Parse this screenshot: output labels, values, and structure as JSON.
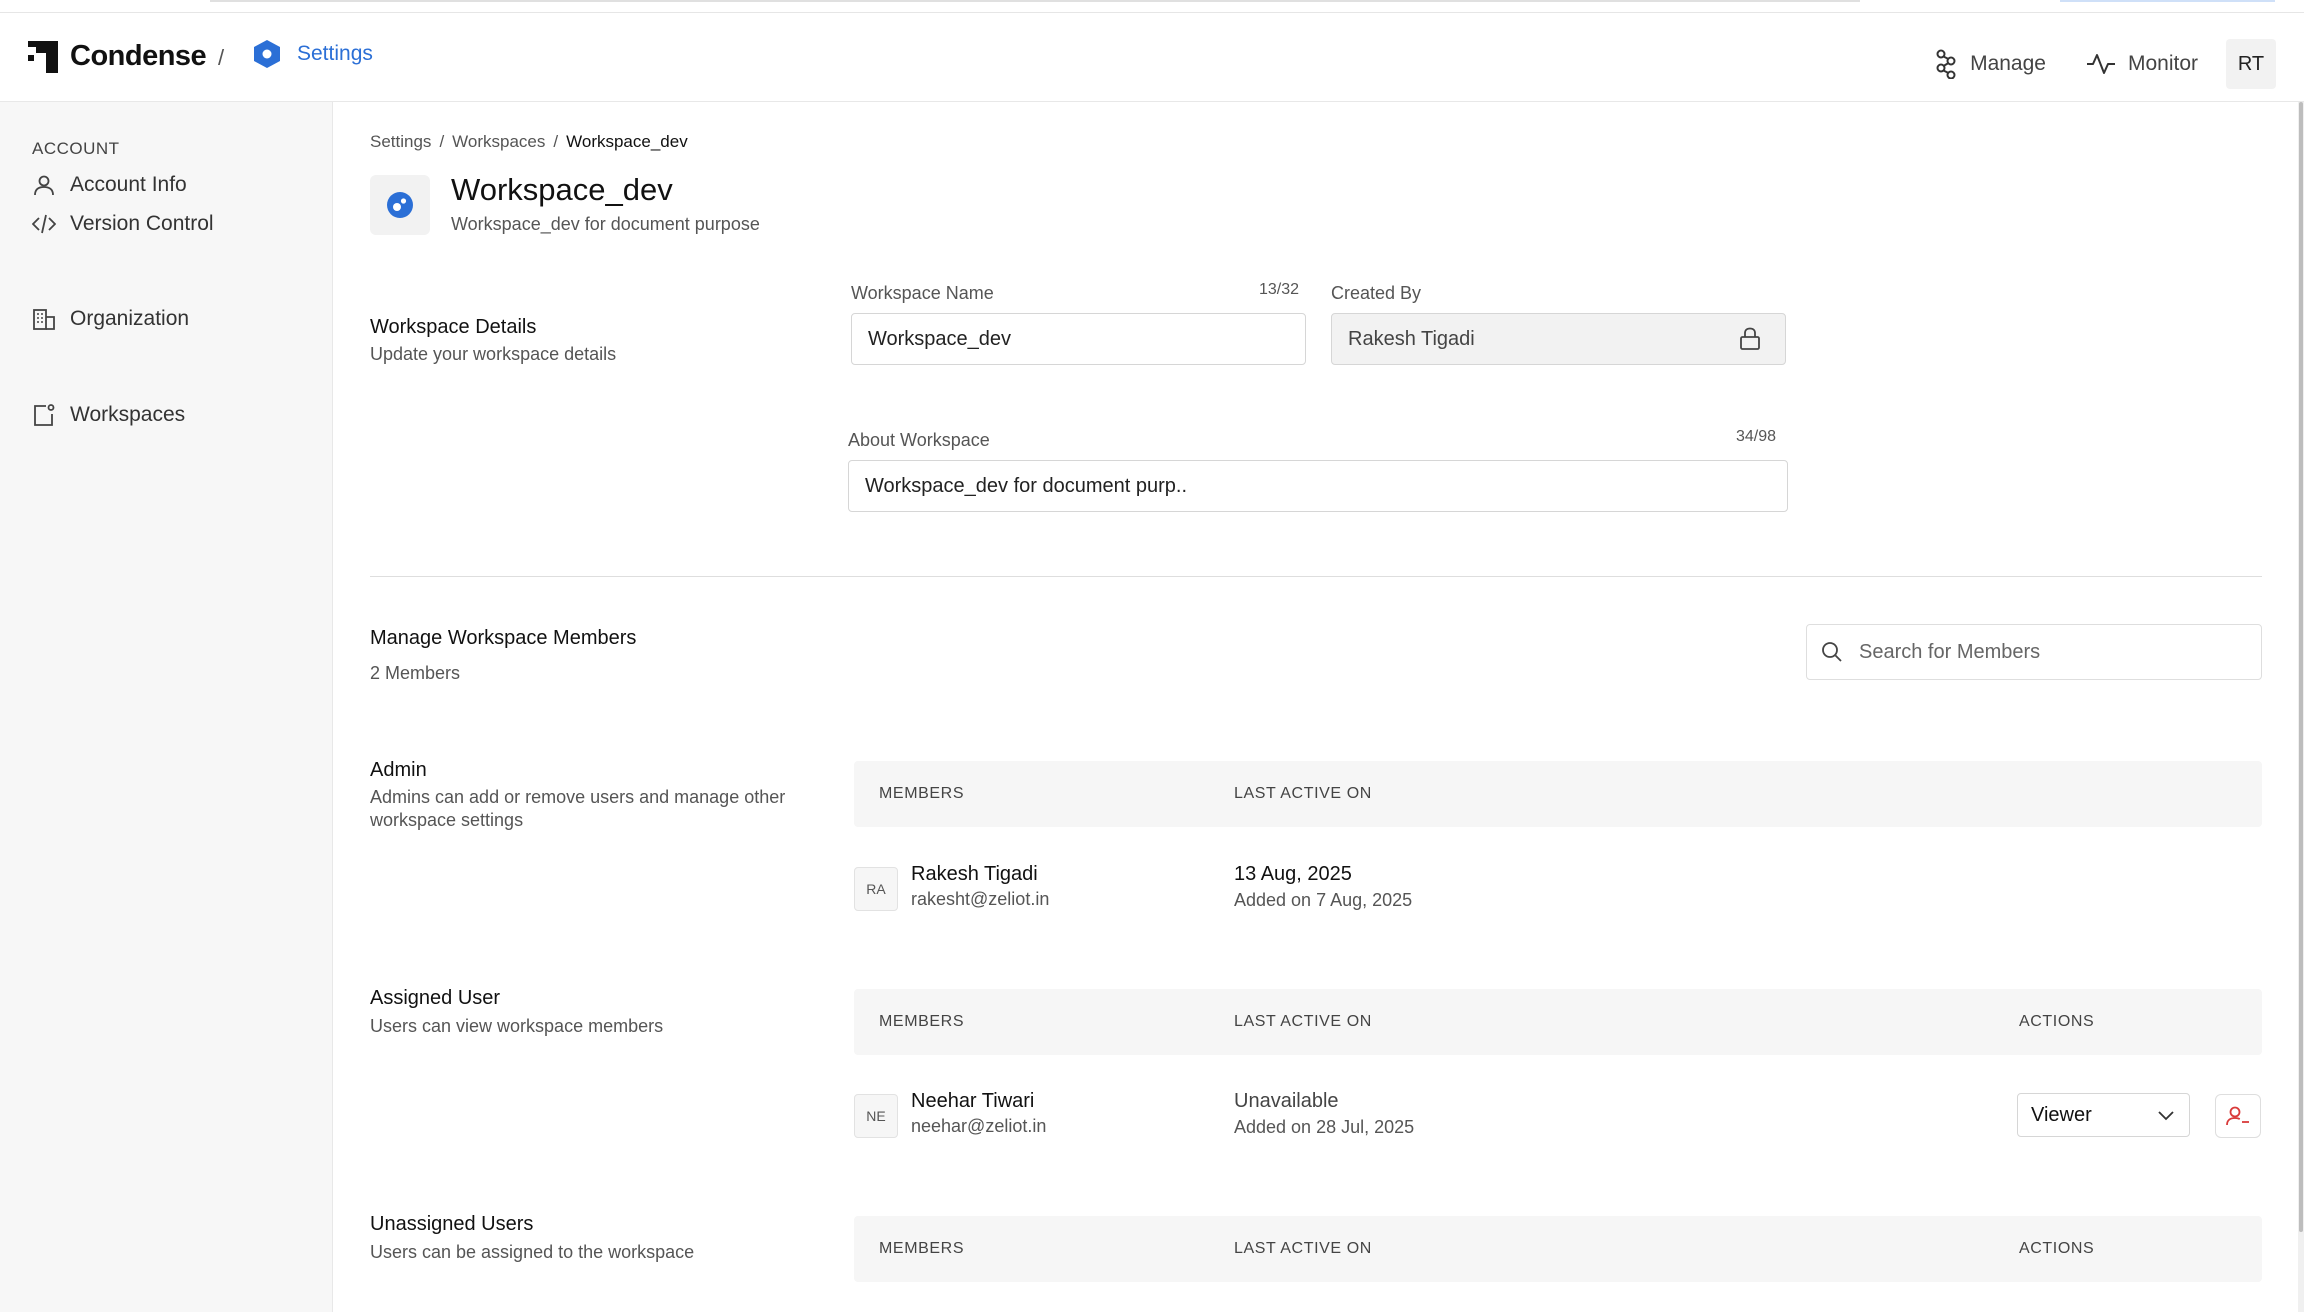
{
  "app": {
    "name": "Condense",
    "section": "Settings"
  },
  "nav": {
    "manage": "Manage",
    "monitor": "Monitor",
    "user_initials": "RT"
  },
  "sidebar": {
    "heading": "ACCOUNT",
    "items": [
      {
        "label": "Account Info",
        "icon": "user-icon"
      },
      {
        "label": "Version Control",
        "icon": "code-icon"
      },
      {
        "label": "Organization",
        "icon": "building-icon"
      },
      {
        "label": "Workspaces",
        "icon": "workspace-icon"
      }
    ]
  },
  "breadcrumb": [
    "Settings",
    "Workspaces",
    "Workspace_dev"
  ],
  "workspace": {
    "title": "Workspace_dev",
    "subtitle": "Workspace_dev for document purpose"
  },
  "details": {
    "title": "Workspace Details",
    "desc": "Update your workspace details",
    "name_label": "Workspace Name",
    "name_counter": "13/32",
    "name_value": "Workspace_dev",
    "created_label": "Created By",
    "created_value": "Rakesh Tigadi",
    "about_label": "About Workspace",
    "about_counter": "34/98",
    "about_value": "Workspace_dev for document purp.."
  },
  "members": {
    "title": "Manage Workspace Members",
    "count": "2 Members",
    "search_placeholder": "Search for Members"
  },
  "columns": {
    "members": "MEMBERS",
    "last_active": "LAST ACTIVE ON",
    "actions": "ACTIONS"
  },
  "admin": {
    "title": "Admin",
    "desc": "Admins can add or remove users and manage other workspace settings",
    "rows": [
      {
        "initials": "RA",
        "name": "Rakesh Tigadi",
        "email": "rakesht@zeliot.in",
        "active": "13 Aug, 2025",
        "added": "Added on 7 Aug, 2025"
      }
    ]
  },
  "assigned": {
    "title": "Assigned User",
    "desc": "Users can view workspace members",
    "rows": [
      {
        "initials": "NE",
        "name": "Neehar Tiwari",
        "email": "neehar@zeliot.in",
        "active": "Unavailable",
        "added": "Added on 28 Jul, 2025",
        "role": "Viewer"
      }
    ]
  },
  "unassigned": {
    "title": "Unassigned Users",
    "desc": "Users can be assigned to the workspace"
  },
  "colors": {
    "accent": "#2b6fd6",
    "danger": "#d93a3a"
  }
}
